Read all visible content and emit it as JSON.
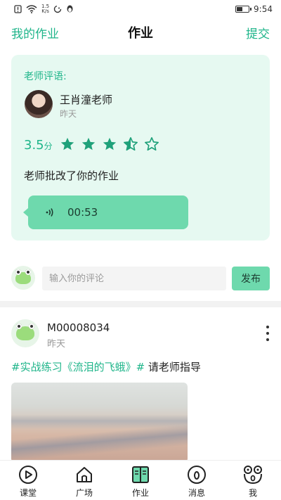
{
  "status_bar": {
    "speed": "1.5",
    "speed_unit": "K/s",
    "battery_level": 0.5,
    "time": "9:54"
  },
  "header": {
    "left_link": "我的作业",
    "title": "作业",
    "right_link": "提交"
  },
  "review": {
    "label": "老师评语:",
    "teacher_name": "王肖潼老师",
    "time": "昨天",
    "score": "3.5",
    "score_unit": "分",
    "rating": 3.5,
    "rating_max": 5,
    "comment": "老师批改了你的作业",
    "voice_duration": "00:53"
  },
  "comment_box": {
    "placeholder": "输入你的评论",
    "publish_label": "发布"
  },
  "post": {
    "username": "M00008034",
    "time": "昨天",
    "tag_text": "#实战练习《流泪的飞蛾》#",
    "text": " 请老师指导"
  },
  "nav": {
    "items": [
      {
        "label": "课堂",
        "icon": "play-circle-icon"
      },
      {
        "label": "广场",
        "icon": "home-icon"
      },
      {
        "label": "作业",
        "icon": "book-icon"
      },
      {
        "label": "消息",
        "icon": "message-icon"
      },
      {
        "label": "我",
        "icon": "frog-face-icon"
      }
    ]
  },
  "colors": {
    "accent": "#1fb58a",
    "accent_light": "#6ed9ad",
    "card_bg": "#e6f9f1"
  }
}
